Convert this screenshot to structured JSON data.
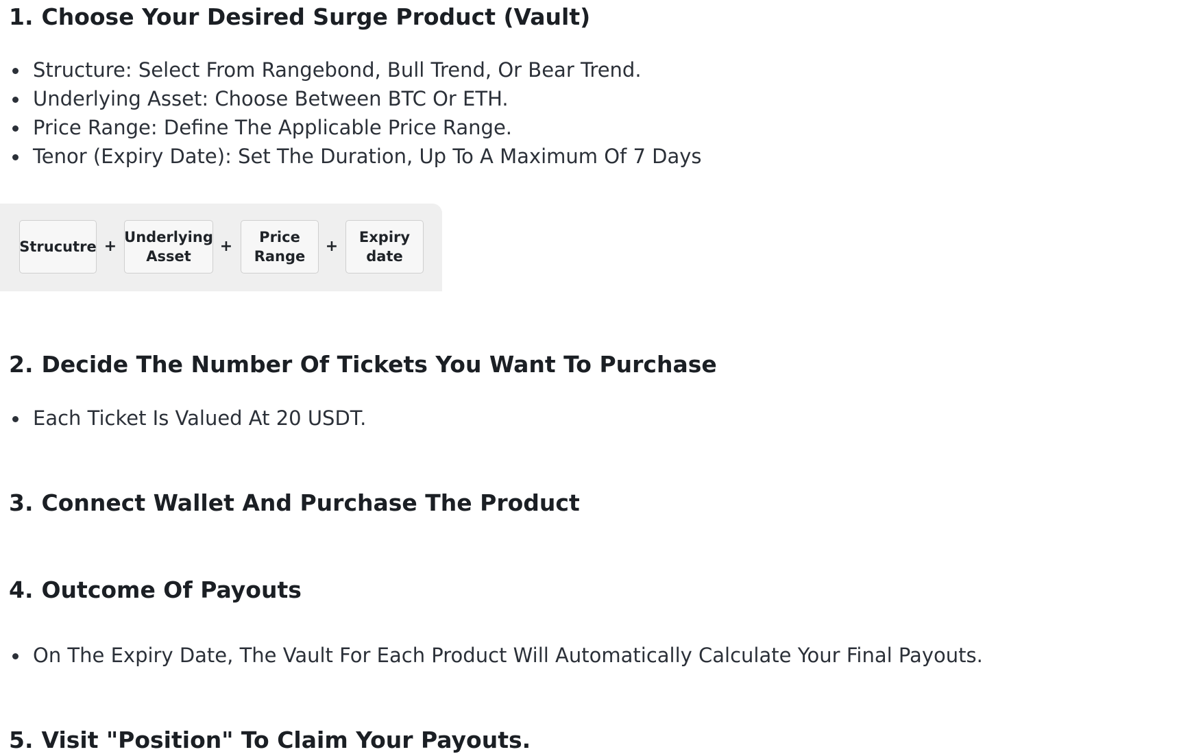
{
  "steps": [
    {
      "number": "1.",
      "title": "Choose Your Desired Surge Product (Vault)",
      "bullets": [
        "Structure: Select From Rangebond, Bull Trend, Or Bear Trend.",
        "Underlying Asset: Choose Between BTC Or ETH.",
        "Price Range: Define The Applicable Price Range.",
        "Tenor (Expiry Date): Set The Duration, Up To A Maximum Of 7 Days"
      ]
    },
    {
      "number": "2.",
      "title": "Decide The Number Of Tickets You Want To Purchase",
      "bullets": [
        "Each Ticket Is Valued At 20 USDT."
      ]
    },
    {
      "number": "3.",
      "title": "Connect Wallet And Purchase The Product",
      "bullets": []
    },
    {
      "number": "4.",
      "title": "Outcome Of Payouts",
      "bullets": [
        "On The Expiry Date, The Vault For Each Product Will Automatically Calculate Your Final Payouts."
      ]
    },
    {
      "number": "5.",
      "title": "Visit \"Position\" To Claim Your Payouts.",
      "bullets": []
    }
  ],
  "flow": {
    "boxes": [
      "Strucutre",
      "Underlying\nAsset",
      "Price\nRange",
      "Expiry\ndate"
    ],
    "separator": "+"
  },
  "colors": {
    "text": "#2b3038",
    "heading": "#1b1f24",
    "flow_background": "#efefef",
    "box_border": "#cfcfcf"
  }
}
